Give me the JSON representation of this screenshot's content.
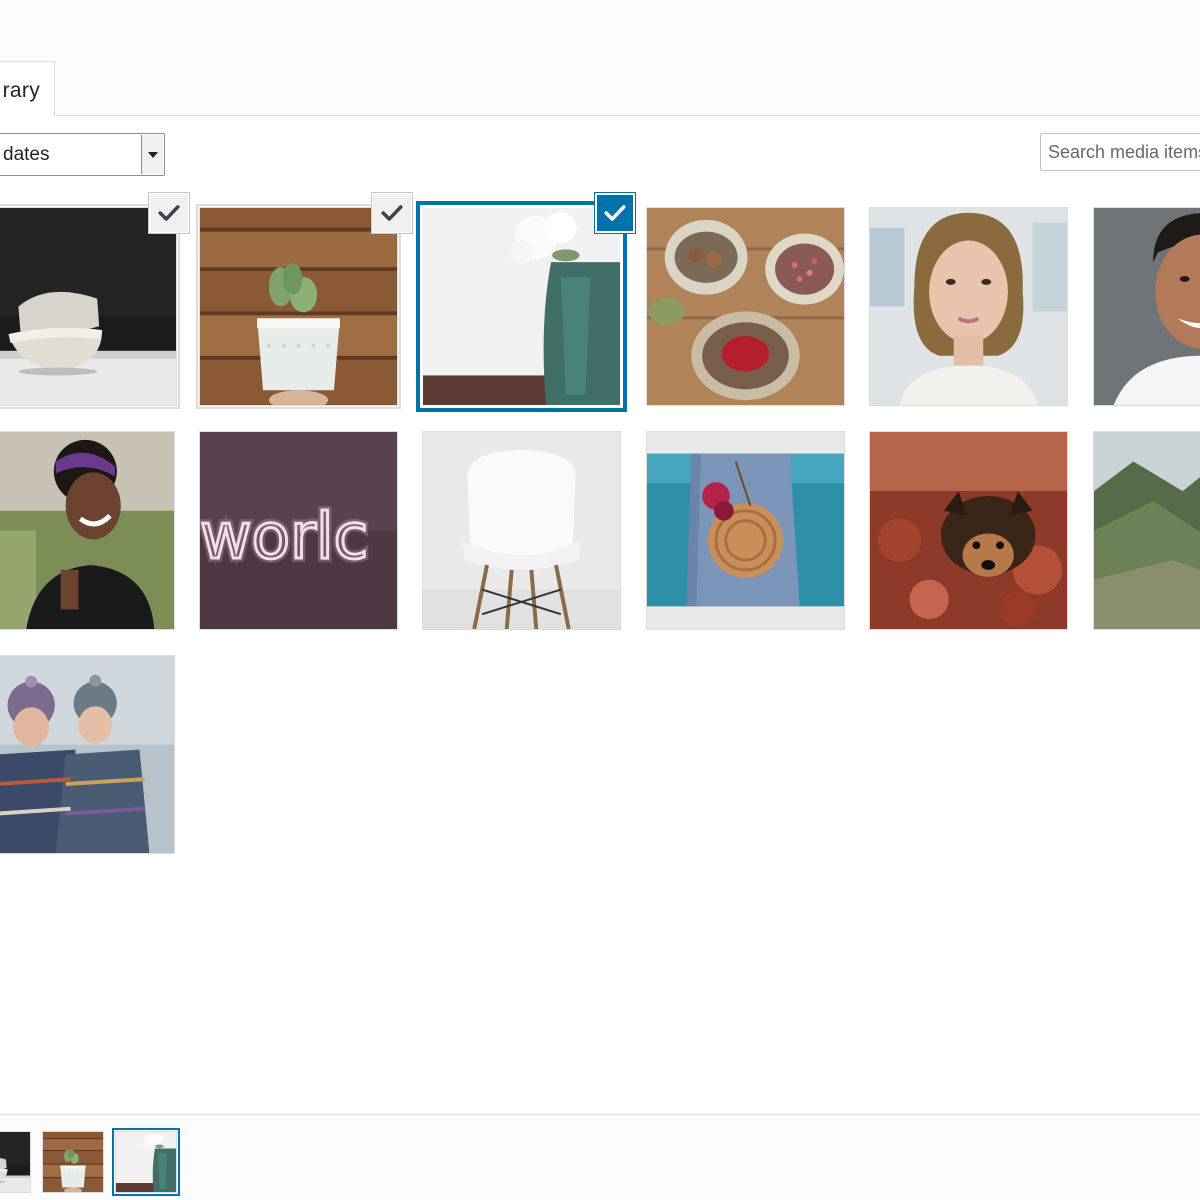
{
  "tabs": {
    "media_library": "rary"
  },
  "toolbar": {
    "date_filter": "dates",
    "search_placeholder": "Search media items..."
  },
  "attachments": [
    {
      "icon": "ceramic-bowls-image",
      "selected": true,
      "focused": false
    },
    {
      "icon": "cactus-pot-image",
      "selected": true,
      "focused": false
    },
    {
      "icon": "flower-vase-image",
      "selected": true,
      "focused": true
    },
    {
      "icon": "spice-bowls-image",
      "selected": false,
      "focused": false
    },
    {
      "icon": "woman-portrait-image",
      "selected": false,
      "focused": false
    },
    {
      "icon": "man-portrait-image",
      "selected": false,
      "focused": false
    },
    {
      "icon": "laughing-woman-image",
      "selected": false,
      "focused": false
    },
    {
      "icon": "neon-world-sign-image",
      "selected": false,
      "focused": false
    },
    {
      "icon": "white-chair-image",
      "selected": false,
      "focused": false
    },
    {
      "icon": "woven-bag-image",
      "selected": false,
      "focused": false
    },
    {
      "icon": "dog-in-leaves-image",
      "selected": false,
      "focused": false
    },
    {
      "icon": "mountain-landscape-image",
      "selected": false,
      "focused": false
    },
    {
      "icon": "winter-friends-image",
      "selected": false,
      "focused": false
    }
  ],
  "selection_bar": [
    "ceramic-bowls-image",
    "cactus-pot-image",
    "flower-vase-image"
  ],
  "colors": {
    "accent": "#0073aa",
    "border": "#dcdcde",
    "check_bg": "#f0f0f1"
  }
}
